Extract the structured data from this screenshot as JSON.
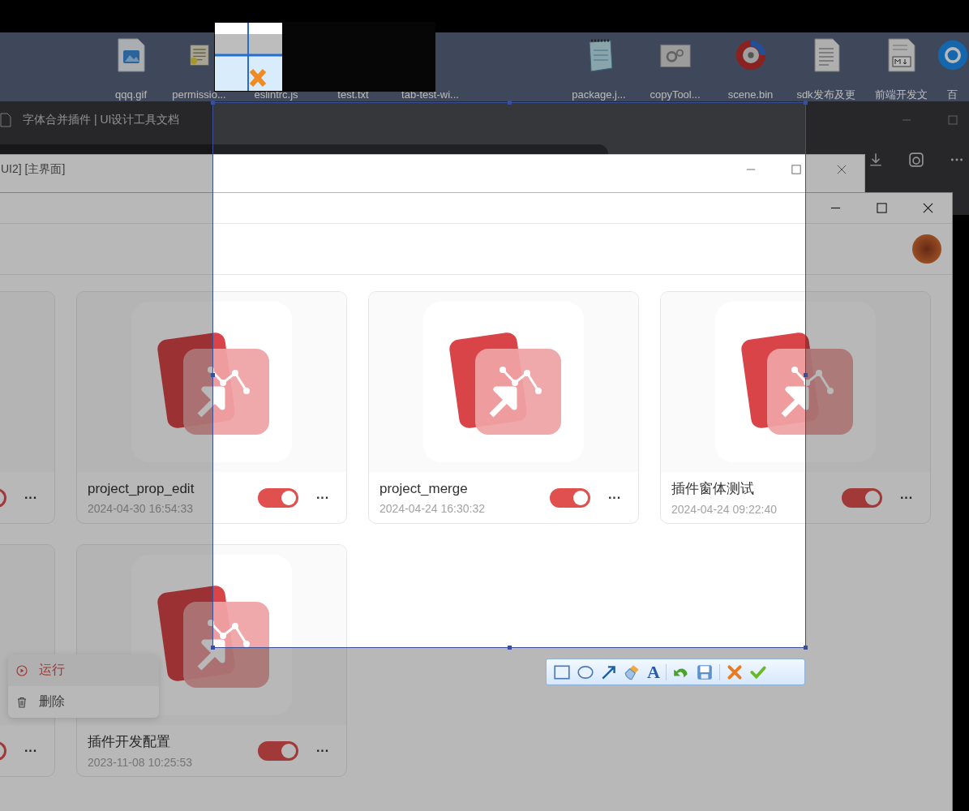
{
  "desktop": {
    "icons": [
      {
        "label": "qqq.gif",
        "kind": "image"
      },
      {
        "label": "permissio...",
        "kind": "script"
      },
      {
        "label": "eslintrc.js",
        "kind": "none"
      },
      {
        "label": "test.txt",
        "kind": "none"
      },
      {
        "label": "tab-test-wi...",
        "kind": "none"
      },
      {
        "label": "package.j...",
        "kind": "notepad"
      },
      {
        "label": "copyTool...",
        "kind": "gear"
      },
      {
        "label": "scene.bin",
        "kind": "disc"
      },
      {
        "label": "sdk发布及更",
        "kind": "doc"
      },
      {
        "label": "前端开发文",
        "kind": "markdown"
      },
      {
        "label": "百",
        "kind": "browser"
      }
    ]
  },
  "browser": {
    "tab_title": "字体合并插件 | UI设计工具文档"
  },
  "back_window": {
    "title": "UI2] [主界面]"
  },
  "app": {
    "cards": [
      {
        "on": true,
        "menu": "···"
      },
      {
        "name": "project_prop_edit",
        "date": "2024-04-30 16:54:33",
        "on": true,
        "menu": "···"
      },
      {
        "name": "project_merge",
        "date": "2024-04-24 16:30:32",
        "on": true,
        "menu": "···"
      },
      {
        "name": "插件窗体测试",
        "date": "2024-04-24 09:22:40",
        "on": true,
        "menu": "···"
      },
      {
        "on": true,
        "menu": "···"
      },
      {
        "name": "插件开发配置",
        "date": "2023-11-08 10:25:53",
        "on": true,
        "menu": "···"
      }
    ],
    "context_menu": [
      {
        "label": "运行",
        "kind": "run",
        "selected": true
      },
      {
        "label": "删除",
        "kind": "delete",
        "selected": false
      }
    ]
  },
  "capture_toolbar": {
    "tools": [
      {
        "kind": "rectangle"
      },
      {
        "kind": "ellipse"
      },
      {
        "kind": "arrow"
      },
      {
        "kind": "brush"
      },
      {
        "kind": "text",
        "label": "A"
      },
      {
        "kind": "undo"
      },
      {
        "kind": "save"
      },
      {
        "kind": "cancel"
      },
      {
        "kind": "confirm"
      }
    ]
  }
}
